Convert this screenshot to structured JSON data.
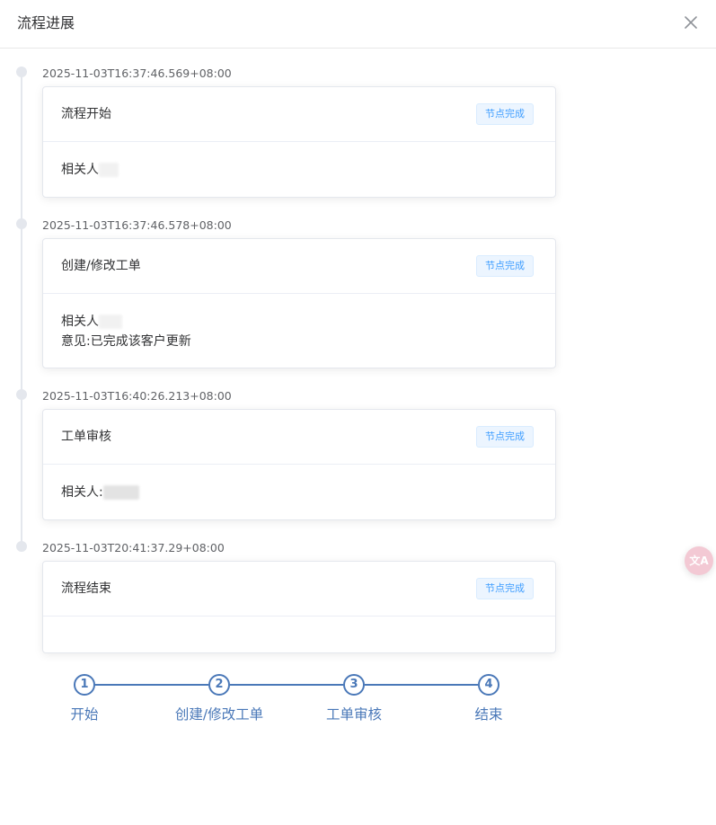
{
  "dialog": {
    "title": "流程进展"
  },
  "timeline": [
    {
      "time": "2025-11-03T16:37:46.569+08:00",
      "title": "流程开始",
      "tag": "节点完成",
      "lines": [
        "相关人"
      ]
    },
    {
      "time": "2025-11-03T16:37:46.578+08:00",
      "title": "创建/修改工单",
      "tag": "节点完成",
      "lines": [
        "相关人",
        "意见:已完成该客户更新"
      ]
    },
    {
      "time": "2025-11-03T16:40:26.213+08:00",
      "title": "工单审核",
      "tag": "节点完成",
      "lines": [
        "相关人:"
      ]
    },
    {
      "time": "2025-11-03T20:41:37.29+08:00",
      "title": "流程结束",
      "tag": "节点完成",
      "lines": []
    }
  ],
  "steps": [
    {
      "number": "1",
      "label": "开始"
    },
    {
      "number": "2",
      "label": "创建/修改工单"
    },
    {
      "number": "3",
      "label": "工单审核"
    },
    {
      "number": "4",
      "label": "结束"
    }
  ],
  "colors": {
    "accent": "#4a78b8",
    "tag_text": "#409eff",
    "tag_bg": "#ecf5ff"
  },
  "icons": {
    "close": "close-icon",
    "translate": "translate-icon"
  },
  "translate_fab": {
    "label": "文A"
  }
}
